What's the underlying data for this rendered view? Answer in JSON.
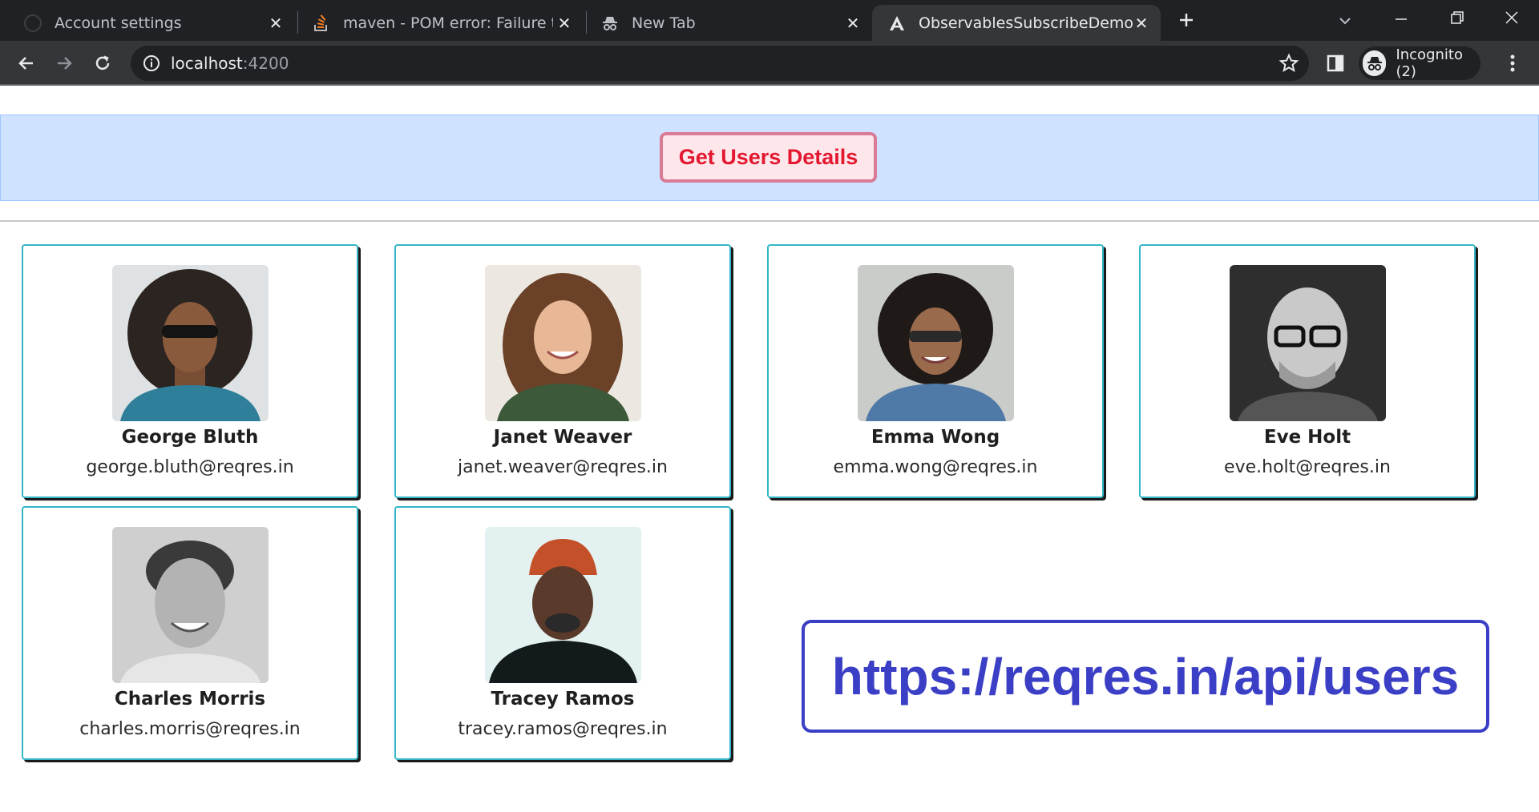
{
  "browser": {
    "tabs": [
      {
        "title": "Account settings",
        "icon": "github-icon",
        "active": false
      },
      {
        "title": "maven - POM error: Failure to fin",
        "icon": "stackoverflow-icon",
        "active": false
      },
      {
        "title": "New Tab",
        "icon": "incognito-icon",
        "active": false
      },
      {
        "title": "ObservablesSubscribeDemo",
        "icon": "angular-icon",
        "active": true
      }
    ],
    "address": {
      "host": "localhost",
      "port": ":4200"
    },
    "profile_label": "Incognito (2)"
  },
  "page": {
    "button_label": "Get Users Details",
    "users": [
      {
        "name": "George Bluth",
        "email": "george.bluth@reqres.in"
      },
      {
        "name": "Janet Weaver",
        "email": "janet.weaver@reqres.in"
      },
      {
        "name": "Emma Wong",
        "email": "emma.wong@reqres.in"
      },
      {
        "name": "Eve Holt",
        "email": "eve.holt@reqres.in"
      },
      {
        "name": "Charles Morris",
        "email": "charles.morris@reqres.in"
      },
      {
        "name": "Tracey Ramos",
        "email": "tracey.ramos@reqres.in"
      }
    ],
    "api_url": "https://reqres.in/api/users"
  },
  "colors": {
    "header_band": "#cfe2ff",
    "button_text": "#e3172f",
    "card_border": "#33b6c7",
    "api_text": "#3b3fc6"
  }
}
